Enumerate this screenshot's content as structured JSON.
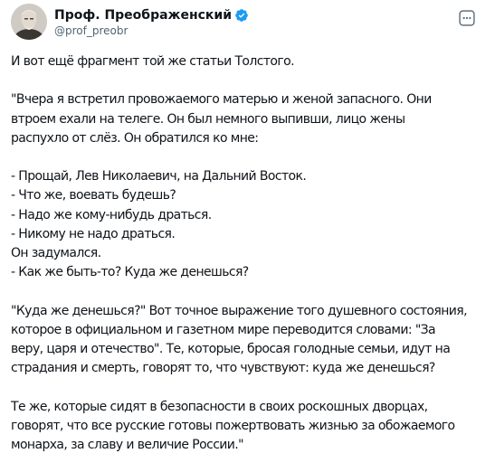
{
  "author": {
    "display_name": "Проф. Преображенский",
    "handle": "@prof_preobr",
    "verified": true,
    "avatar_icon": "portrait-avatar",
    "verified_color": "#1d9bf0"
  },
  "menu": {
    "icon": "more-icon"
  },
  "tweet": {
    "paragraphs": [
      {
        "lines": [
          "И вот ещё фрагмент той же статьи Толстого."
        ]
      },
      {
        "lines": [
          "\"Вчера я встретил провожаемого матерью и женой запасного. Они",
          "втроем ехали на телеге. Он был немного выпивши, лицо жены",
          "распухло от слёз. Он обратился ко мне:"
        ]
      },
      {
        "lines": [
          "- Прощай, Лев Николаевич, на Дальний Восток.",
          "- Что же, воевать будешь?",
          "- Надо же кому-нибудь драться.",
          "- Никому не надо драться.",
          "Он задумался.",
          "- Как же быть-то? Куда же денешься?"
        ]
      },
      {
        "lines": [
          "\"Куда же денешься?\" Вот точное выражение того душевного состояния,",
          "которое в официальном и газетном мире переводится словами: \"За",
          "веру, царя и отечество\". Те, которые, бросая голодные семьи, идут на",
          "страдания и смерть, говорят то, что чувствуют: куда же денешься?"
        ]
      },
      {
        "lines": [
          "Те же, которые сидят в безопасности в своих роскошных дворцах,",
          "говорят, что все русские готовы пожертвовать жизнью за обожаемого",
          "монарха, за славу и величие России.\""
        ]
      }
    ]
  }
}
